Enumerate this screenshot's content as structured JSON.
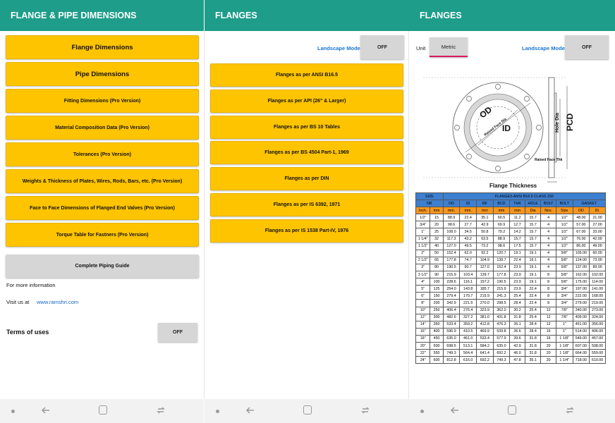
{
  "colors": {
    "appbar": "#1e9d8a",
    "button_yellow": "#ffc400",
    "button_gray": "#d6d6d6",
    "link": "#1565c0",
    "landscape_label": "#1976d2",
    "table_header_blue": "#3d7fd0",
    "table_header_orange": "#f6961e"
  },
  "panel1": {
    "title": "FLANGE & PIPE DIMENSIONS",
    "buttons": [
      "Flange Dimensions",
      "Pipe Dimensions",
      "Fitting Dimensions (Pro Version)",
      "Material Composition Data (Pro Version)",
      "Tolerances (Pro Version)",
      "Weights & Thickness of Plates, Wires, Rods, Bars, etc. (Pro Version)",
      "Face to Face Dimensions of Flanged End Valves (Pro Version)",
      "Torque Table for Fastners (Pro Version)"
    ],
    "guide_button": "Complete Piping Guide",
    "more_info": "For more information",
    "visit_label": "Visit us at",
    "visit_link": "www.ramshri.com",
    "terms_label": "Terms of uses",
    "terms_toggle": "OFF"
  },
  "panel2": {
    "title": "FLANGES",
    "landscape_label": "Landscape Mode",
    "landscape_toggle": "OFF",
    "buttons": [
      "Flanges as per ANSI B16.5",
      "Flanges as per API (26\" & Larger)",
      "Flanges as per BS 10 Tables",
      "Flanges as per BS 4504 Part-1, 1969",
      "Flanges as per DIN",
      "Flanges as per IS 6392, 1971",
      "Flanges as per IS 1538 Part-IV, 1976"
    ]
  },
  "panel3": {
    "title": "FLANGES",
    "unit_label": "Unit",
    "unit_value": "Metric",
    "landscape_label": "Landscape Mode",
    "landscape_toggle": "OFF",
    "drawing": {
      "od": "OD",
      "id": "ID",
      "raised_face_dia": "Raised Face Dia",
      "hole_dia": "Hole Dia",
      "pcd": "PCD",
      "raised_face_thk": "Raised Face Thk",
      "flange_thickness": "Flange Thickness"
    },
    "table": {
      "size_header": "SIZE",
      "title": "FLANGES ANSI B16.5 CLASS 150",
      "col_groups": [
        "NB",
        "OD",
        "ID",
        "RF",
        "BCD",
        "THK",
        "HOLE",
        "BOLT",
        "BOLT",
        "GASKET"
      ],
      "units": [
        "Inch.",
        "mm",
        "mm.",
        "mm.",
        "mm",
        "mm",
        "mm",
        "Dia",
        "Nos.",
        "Size",
        "OD",
        "ID."
      ],
      "rows": [
        [
          "1/2\"",
          "15",
          "88.9",
          "22.4",
          "35.1",
          "60.5",
          "11.2",
          "15.7",
          "4",
          "1/2\"",
          "48.00",
          "21.00"
        ],
        [
          "3/4\"",
          "20",
          "98.6",
          "27.7",
          "42.9",
          "69.9",
          "12.7",
          "15.7",
          "4",
          "1/2\"",
          "57.00",
          "27.00"
        ],
        [
          "1\"",
          "25",
          "108.0",
          "34.5",
          "50.8",
          "79.2",
          "14.2",
          "15.7",
          "4",
          "1/2\"",
          "67.00",
          "33.00"
        ],
        [
          "1 1/4\"",
          "32",
          "117.3",
          "43.2",
          "63.5",
          "88.9",
          "15.7",
          "15.7",
          "4",
          "1/2\"",
          "76.00",
          "42.00"
        ],
        [
          "1 1/2\"",
          "40",
          "127.0",
          "49.5",
          "73.2",
          "98.6",
          "17.5",
          "15.7",
          "4",
          "1/2\"",
          "86.00",
          "49.00"
        ],
        [
          "2\"",
          "50",
          "152.4",
          "62.0",
          "92.2",
          "120.7",
          "19.1",
          "19.1",
          "4",
          "5/8\"",
          "105.00",
          "60.00"
        ],
        [
          "2 1/2\"",
          "65",
          "177.8",
          "74.7",
          "104.9",
          "139.7",
          "22.4",
          "19.1",
          "4",
          "5/8\"",
          "124.00",
          "73.00"
        ],
        [
          "3\"",
          "80",
          "190.5",
          "90.7",
          "127.0",
          "152.4",
          "23.9",
          "19.1",
          "4",
          "5/8\"",
          "137.00",
          "89.00"
        ],
        [
          "3 1/2\"",
          "90",
          "215.9",
          "103.4",
          "139.7",
          "177.8",
          "23.9",
          "19.1",
          "8",
          "5/8\"",
          "162.00",
          "102.00"
        ],
        [
          "4\"",
          "100",
          "228.6",
          "116.1",
          "157.2",
          "190.5",
          "23.9",
          "19.1",
          "8",
          "5/8\"",
          "175.00",
          "114.00"
        ],
        [
          "5\"",
          "125",
          "254.0",
          "143.8",
          "185.7",
          "215.9",
          "23.9",
          "22.4",
          "8",
          "3/4\"",
          "197.00",
          "141.00"
        ],
        [
          "6\"",
          "150",
          "279.4",
          "170.7",
          "215.9",
          "241.3",
          "25.4",
          "22.4",
          "8",
          "3/4\"",
          "222.00",
          "168.00"
        ],
        [
          "8\"",
          "200",
          "342.9",
          "221.5",
          "270.0",
          "298.5",
          "28.4",
          "22.4",
          "8",
          "3/4\"",
          "279.00",
          "219.00"
        ],
        [
          "10\"",
          "250",
          "406.4",
          "276.4",
          "323.9",
          "362.0",
          "30.2",
          "25.4",
          "12",
          "7/8\"",
          "340.00",
          "273.00"
        ],
        [
          "12\"",
          "300",
          "482.6",
          "327.2",
          "381.0",
          "431.8",
          "31.8",
          "25.4",
          "12",
          "7/8\"",
          "409.00",
          "324.00"
        ],
        [
          "14\"",
          "350",
          "533.4",
          "359.2",
          "412.8",
          "476.3",
          "35.1",
          "28.4",
          "12",
          "1\"",
          "451.00",
          "356.00"
        ],
        [
          "16\"",
          "400",
          "596.9",
          "410.5",
          "469.9",
          "539.8",
          "36.6",
          "28.4",
          "16",
          "1\"",
          "514.00",
          "406.00"
        ],
        [
          "18\"",
          "450",
          "635.0",
          "461.0",
          "533.4",
          "577.9",
          "39.6",
          "31.8",
          "16",
          "1 1/8\"",
          "549.00",
          "457.00"
        ],
        [
          "20\"",
          "500",
          "698.5",
          "513.1",
          "584.2",
          "635.0",
          "42.9",
          "31.8",
          "20",
          "1 1/8\"",
          "607.00",
          "508.00"
        ],
        [
          "22\"",
          "550",
          "749.3",
          "564.4",
          "641.4",
          "692.2",
          "46.0",
          "31.8",
          "20",
          "1 1/8\"",
          "664.00",
          "559.00"
        ],
        [
          "24\"",
          "600",
          "812.8",
          "616.0",
          "692.2",
          "749.3",
          "47.8",
          "35.1",
          "20",
          "1 1/4\"",
          "718.00",
          "610.00"
        ]
      ]
    }
  }
}
